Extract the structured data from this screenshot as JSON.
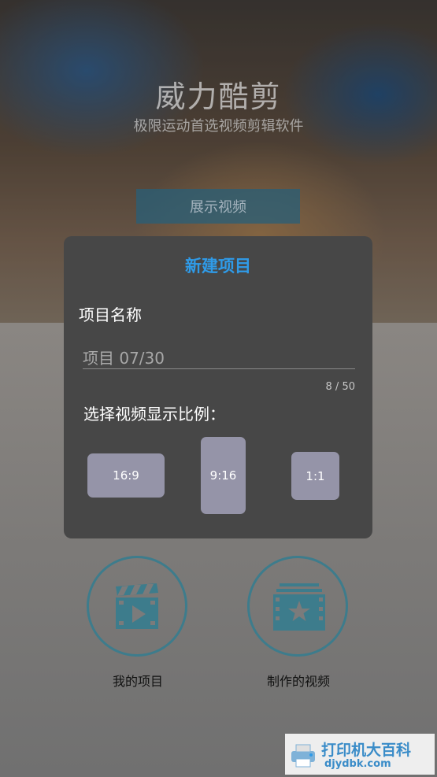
{
  "header": {
    "app_title": "威力酷剪",
    "app_subtitle": "极限运动首选视频剪辑软件",
    "showcase_button": "展示视频"
  },
  "dialog": {
    "title": "新建项目",
    "name_label": "项目名称",
    "name_value": "项目 07/30",
    "char_count": "8 / 50",
    "ratio_label": "选择视频显示比例：",
    "ratios": [
      "16:9",
      "9:16",
      "1:1"
    ]
  },
  "shortcuts": {
    "my_projects": "我的项目",
    "made_videos": "制作的视频"
  },
  "watermark": {
    "main": "打印机大百科",
    "url": "djydbk.com"
  },
  "colors": {
    "accent": "#2f9be8",
    "ratio_button": "#9594a8",
    "icon_teal": "#3d7c8c"
  }
}
